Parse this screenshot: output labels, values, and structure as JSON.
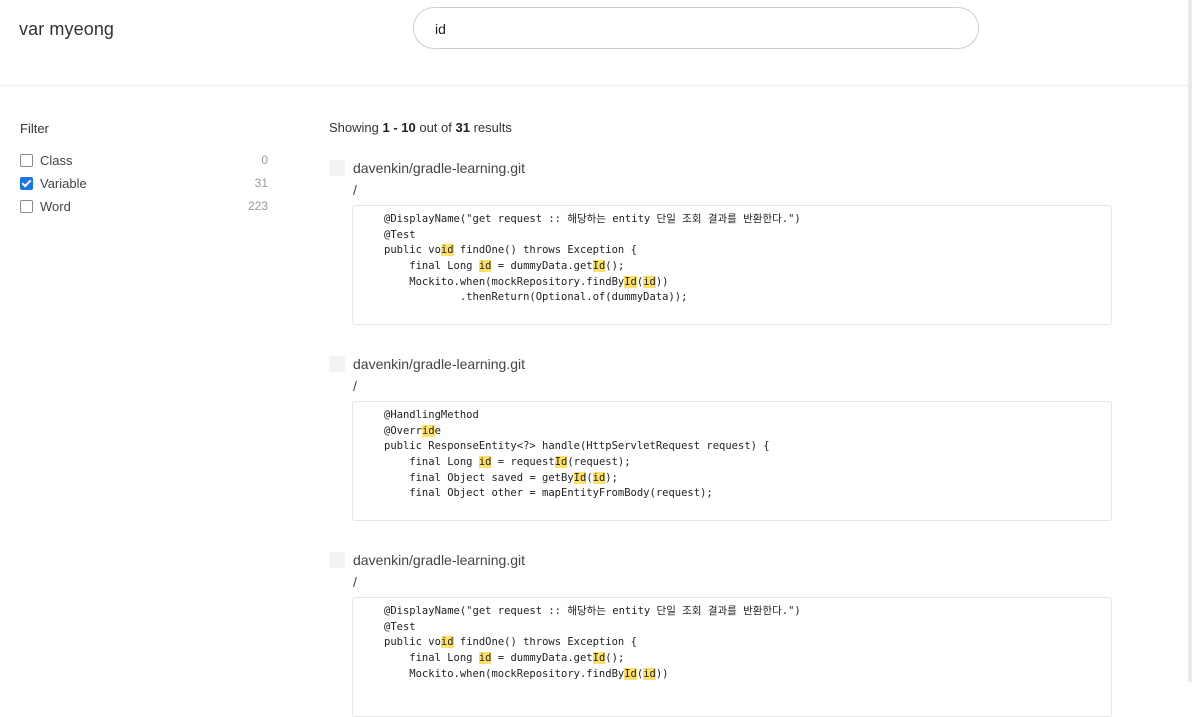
{
  "header": {
    "brand": "var myeong",
    "search_value": "id"
  },
  "filter": {
    "title": "Filter",
    "options": [
      {
        "label": "Class",
        "count": "0",
        "checked": false
      },
      {
        "label": "Variable",
        "count": "31",
        "checked": true
      },
      {
        "label": "Word",
        "count": "223",
        "checked": false
      }
    ]
  },
  "results": {
    "summary": {
      "prefix": "Showing ",
      "range": "1 - 10",
      "middle": " out of ",
      "total": "31",
      "suffix": " results"
    },
    "items": [
      {
        "repo": "davenkin/gradle-learning.git",
        "path": "/",
        "lines": [
          [
            {
              "t": "@DisplayName(\"get request :: 해당하는 entity 단일 조회 결과를 반환한다.\")"
            }
          ],
          [
            {
              "t": "@Test"
            }
          ],
          [
            {
              "t": "public vo"
            },
            {
              "t": "id",
              "h": true
            },
            {
              "t": " findOne() throws Exception {"
            }
          ],
          [
            {
              "t": "    final Long "
            },
            {
              "t": "id",
              "h": true
            },
            {
              "t": " = dummyData.get"
            },
            {
              "t": "Id",
              "h": true
            },
            {
              "t": "();"
            }
          ],
          [
            {
              "t": "    Mockito.when(mockRepository.findBy"
            },
            {
              "t": "Id",
              "h": true
            },
            {
              "t": "("
            },
            {
              "t": "id",
              "h": true
            },
            {
              "t": "))"
            }
          ],
          [
            {
              "t": "            .thenReturn(Optional.of(dummyData));"
            }
          ]
        ]
      },
      {
        "repo": "davenkin/gradle-learning.git",
        "path": "/",
        "lines": [
          [
            {
              "t": "@HandlingMethod"
            }
          ],
          [
            {
              "t": "@Overr"
            },
            {
              "t": "id",
              "h": true
            },
            {
              "t": "e"
            }
          ],
          [
            {
              "t": "public ResponseEntity<?> handle(HttpServletRequest request) {"
            }
          ],
          [
            {
              "t": "    final Long "
            },
            {
              "t": "id",
              "h": true
            },
            {
              "t": " = request"
            },
            {
              "t": "Id",
              "h": true
            },
            {
              "t": "(request);"
            }
          ],
          [
            {
              "t": "    final Object saved = getBy"
            },
            {
              "t": "Id",
              "h": true
            },
            {
              "t": "("
            },
            {
              "t": "id",
              "h": true
            },
            {
              "t": ");"
            }
          ],
          [
            {
              "t": "    final Object other = mapEntityFromBody(request);"
            }
          ]
        ]
      },
      {
        "repo": "davenkin/gradle-learning.git",
        "path": "/",
        "lines": [
          [
            {
              "t": "@DisplayName(\"get request :: 해당하는 entity 단일 조회 결과를 반환한다.\")"
            }
          ],
          [
            {
              "t": "@Test"
            }
          ],
          [
            {
              "t": "public vo"
            },
            {
              "t": "id",
              "h": true
            },
            {
              "t": " findOne() throws Exception {"
            }
          ],
          [
            {
              "t": "    final Long "
            },
            {
              "t": "id",
              "h": true
            },
            {
              "t": " = dummyData.get"
            },
            {
              "t": "Id",
              "h": true
            },
            {
              "t": "();"
            }
          ],
          [
            {
              "t": "    Mockito.when(mockRepository.findBy"
            },
            {
              "t": "Id",
              "h": true
            },
            {
              "t": "("
            },
            {
              "t": "id",
              "h": true
            },
            {
              "t": "))"
            }
          ]
        ]
      }
    ]
  },
  "colors": {
    "highlight": "#ffe066",
    "checkbox_accent": "#1a73e8"
  }
}
